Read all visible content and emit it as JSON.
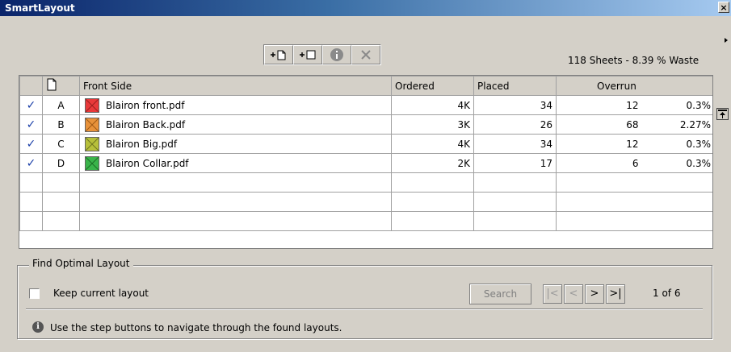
{
  "window": {
    "title": "SmartLayout",
    "close_glyph": "×"
  },
  "toolbar": {
    "buttons": [
      {
        "name": "add-sheet-icon"
      },
      {
        "name": "add-frame-icon"
      },
      {
        "name": "info-icon"
      },
      {
        "name": "delete-icon"
      }
    ]
  },
  "summary": "118 Sheets - 8.39 % Waste",
  "grid": {
    "headers": {
      "name": "Front Side",
      "ordered": "Ordered",
      "placed": "Placed",
      "overrun": "Overrun"
    },
    "rows": [
      {
        "check": "✓",
        "id": "A",
        "name": "Blairon front.pdf",
        "color": "#e8393a",
        "ordered": "4K",
        "placed": "34",
        "overrun": "12",
        "overrun_pct": "0.3%"
      },
      {
        "check": "✓",
        "id": "B",
        "name": "Blairon Back.pdf",
        "color": "#e8923a",
        "ordered": "3K",
        "placed": "26",
        "overrun": "68",
        "overrun_pct": "2.27%"
      },
      {
        "check": "✓",
        "id": "C",
        "name": "Blairon Big.pdf",
        "color": "#b7c03a",
        "ordered": "4K",
        "placed": "34",
        "overrun": "12",
        "overrun_pct": "0.3%"
      },
      {
        "check": "✓",
        "id": "D",
        "name": "Blairon Collar.pdf",
        "color": "#3ab44a",
        "ordered": "2K",
        "placed": "17",
        "overrun": "6",
        "overrun_pct": "0.3%"
      }
    ]
  },
  "optimal": {
    "legend": "Find Optimal Layout",
    "keep_label": "Keep current layout",
    "search_label": "Search",
    "nav": {
      "first": "|<",
      "prev": "<",
      "next": ">",
      "last": ">|"
    },
    "page": "1 of 6",
    "hint": "Use the step buttons to navigate through the found layouts."
  }
}
